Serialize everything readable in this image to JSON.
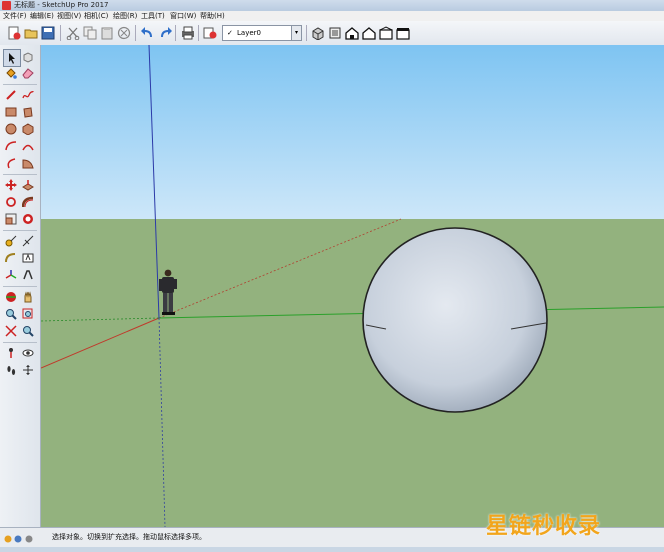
{
  "window": {
    "title": "无标题 - SketchUp Pro 2017"
  },
  "menu": {
    "items": [
      "文件(F)",
      "编辑(E)",
      "视图(V)",
      "相机(C)",
      "绘图(R)",
      "工具(T)",
      "窗口(W)",
      "帮助(H)"
    ]
  },
  "toolbar": {
    "layer": {
      "check": "✓",
      "value": "Layer0",
      "arrow": "▾"
    }
  },
  "status": {
    "text": "选择对象。切换到扩充选择。拖动鼠标选择多项。"
  },
  "watermark": {
    "text": "星链秒收录"
  },
  "colors": {
    "sky": "#8fcdf5",
    "ground": "#93b27e",
    "sphere": "#c7d0dc",
    "axis_red": "#c0392b",
    "axis_green": "#2aa02a",
    "axis_blue": "#2b3aa8",
    "watermark": "#f2a51c"
  }
}
